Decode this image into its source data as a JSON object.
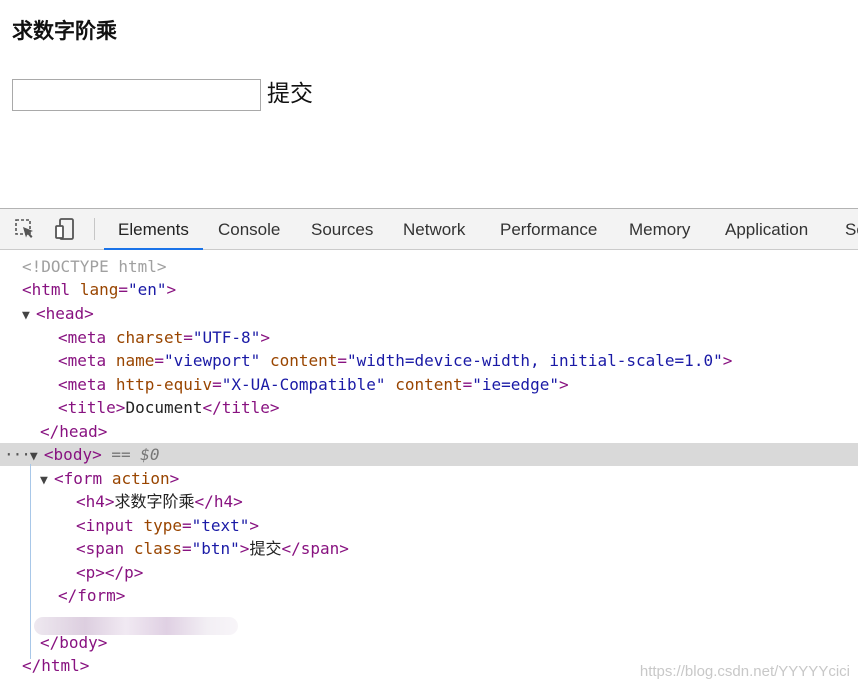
{
  "page": {
    "heading": "求数字阶乘",
    "input_value": "",
    "button_label": "提交"
  },
  "devtools": {
    "tabs": [
      "Elements",
      "Console",
      "Sources",
      "Network",
      "Performance",
      "Memory",
      "Application",
      "Se"
    ],
    "active_tab": "Elements",
    "icons": [
      "inspect-element-icon",
      "device-toolbar-icon"
    ],
    "selection_marker": "== $0",
    "dom": {
      "doctype": "<!DOCTYPE html>",
      "html_open": {
        "tag": "html",
        "attr": "lang",
        "value": "\"en\""
      },
      "head": "head",
      "meta_charset": {
        "attr": "charset",
        "value": "\"UTF-8\""
      },
      "meta_viewport": {
        "attr1": "name",
        "val1": "\"viewport\"",
        "attr2": "content",
        "val2": "\"width=device-width, initial-scale=1.0\""
      },
      "meta_compat": {
        "attr1": "http-equiv",
        "val1": "\"X-UA-Compatible\"",
        "attr2": "content",
        "val2": "\"ie=edge\""
      },
      "title_text": "Document",
      "body": "body",
      "form": {
        "tag": "form",
        "attr": "action"
      },
      "h4_text": "求数字阶乘",
      "input": {
        "attr": "type",
        "value": "\"text\""
      },
      "span": {
        "attr": "class",
        "value": "\"btn\"",
        "text": "提交"
      }
    }
  },
  "watermark": "https://blog.csdn.net/YYYYYcici"
}
